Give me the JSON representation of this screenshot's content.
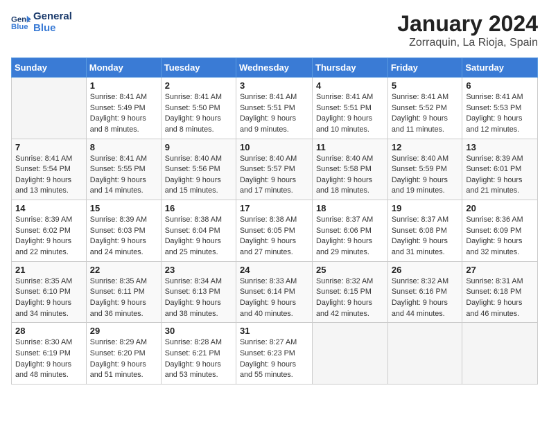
{
  "header": {
    "logo_line1": "General",
    "logo_line2": "Blue",
    "title": "January 2024",
    "subtitle": "Zorraquin, La Rioja, Spain"
  },
  "days_of_week": [
    "Sunday",
    "Monday",
    "Tuesday",
    "Wednesday",
    "Thursday",
    "Friday",
    "Saturday"
  ],
  "weeks": [
    [
      {
        "day": "",
        "detail": ""
      },
      {
        "day": "1",
        "detail": "Sunrise: 8:41 AM\nSunset: 5:49 PM\nDaylight: 9 hours\nand 8 minutes."
      },
      {
        "day": "2",
        "detail": "Sunrise: 8:41 AM\nSunset: 5:50 PM\nDaylight: 9 hours\nand 8 minutes."
      },
      {
        "day": "3",
        "detail": "Sunrise: 8:41 AM\nSunset: 5:51 PM\nDaylight: 9 hours\nand 9 minutes."
      },
      {
        "day": "4",
        "detail": "Sunrise: 8:41 AM\nSunset: 5:51 PM\nDaylight: 9 hours\nand 10 minutes."
      },
      {
        "day": "5",
        "detail": "Sunrise: 8:41 AM\nSunset: 5:52 PM\nDaylight: 9 hours\nand 11 minutes."
      },
      {
        "day": "6",
        "detail": "Sunrise: 8:41 AM\nSunset: 5:53 PM\nDaylight: 9 hours\nand 12 minutes."
      }
    ],
    [
      {
        "day": "7",
        "detail": "Sunrise: 8:41 AM\nSunset: 5:54 PM\nDaylight: 9 hours\nand 13 minutes."
      },
      {
        "day": "8",
        "detail": "Sunrise: 8:41 AM\nSunset: 5:55 PM\nDaylight: 9 hours\nand 14 minutes."
      },
      {
        "day": "9",
        "detail": "Sunrise: 8:40 AM\nSunset: 5:56 PM\nDaylight: 9 hours\nand 15 minutes."
      },
      {
        "day": "10",
        "detail": "Sunrise: 8:40 AM\nSunset: 5:57 PM\nDaylight: 9 hours\nand 17 minutes."
      },
      {
        "day": "11",
        "detail": "Sunrise: 8:40 AM\nSunset: 5:58 PM\nDaylight: 9 hours\nand 18 minutes."
      },
      {
        "day": "12",
        "detail": "Sunrise: 8:40 AM\nSunset: 5:59 PM\nDaylight: 9 hours\nand 19 minutes."
      },
      {
        "day": "13",
        "detail": "Sunrise: 8:39 AM\nSunset: 6:01 PM\nDaylight: 9 hours\nand 21 minutes."
      }
    ],
    [
      {
        "day": "14",
        "detail": "Sunrise: 8:39 AM\nSunset: 6:02 PM\nDaylight: 9 hours\nand 22 minutes."
      },
      {
        "day": "15",
        "detail": "Sunrise: 8:39 AM\nSunset: 6:03 PM\nDaylight: 9 hours\nand 24 minutes."
      },
      {
        "day": "16",
        "detail": "Sunrise: 8:38 AM\nSunset: 6:04 PM\nDaylight: 9 hours\nand 25 minutes."
      },
      {
        "day": "17",
        "detail": "Sunrise: 8:38 AM\nSunset: 6:05 PM\nDaylight: 9 hours\nand 27 minutes."
      },
      {
        "day": "18",
        "detail": "Sunrise: 8:37 AM\nSunset: 6:06 PM\nDaylight: 9 hours\nand 29 minutes."
      },
      {
        "day": "19",
        "detail": "Sunrise: 8:37 AM\nSunset: 6:08 PM\nDaylight: 9 hours\nand 31 minutes."
      },
      {
        "day": "20",
        "detail": "Sunrise: 8:36 AM\nSunset: 6:09 PM\nDaylight: 9 hours\nand 32 minutes."
      }
    ],
    [
      {
        "day": "21",
        "detail": "Sunrise: 8:35 AM\nSunset: 6:10 PM\nDaylight: 9 hours\nand 34 minutes."
      },
      {
        "day": "22",
        "detail": "Sunrise: 8:35 AM\nSunset: 6:11 PM\nDaylight: 9 hours\nand 36 minutes."
      },
      {
        "day": "23",
        "detail": "Sunrise: 8:34 AM\nSunset: 6:13 PM\nDaylight: 9 hours\nand 38 minutes."
      },
      {
        "day": "24",
        "detail": "Sunrise: 8:33 AM\nSunset: 6:14 PM\nDaylight: 9 hours\nand 40 minutes."
      },
      {
        "day": "25",
        "detail": "Sunrise: 8:32 AM\nSunset: 6:15 PM\nDaylight: 9 hours\nand 42 minutes."
      },
      {
        "day": "26",
        "detail": "Sunrise: 8:32 AM\nSunset: 6:16 PM\nDaylight: 9 hours\nand 44 minutes."
      },
      {
        "day": "27",
        "detail": "Sunrise: 8:31 AM\nSunset: 6:18 PM\nDaylight: 9 hours\nand 46 minutes."
      }
    ],
    [
      {
        "day": "28",
        "detail": "Sunrise: 8:30 AM\nSunset: 6:19 PM\nDaylight: 9 hours\nand 48 minutes."
      },
      {
        "day": "29",
        "detail": "Sunrise: 8:29 AM\nSunset: 6:20 PM\nDaylight: 9 hours\nand 51 minutes."
      },
      {
        "day": "30",
        "detail": "Sunrise: 8:28 AM\nSunset: 6:21 PM\nDaylight: 9 hours\nand 53 minutes."
      },
      {
        "day": "31",
        "detail": "Sunrise: 8:27 AM\nSunset: 6:23 PM\nDaylight: 9 hours\nand 55 minutes."
      },
      {
        "day": "",
        "detail": ""
      },
      {
        "day": "",
        "detail": ""
      },
      {
        "day": "",
        "detail": ""
      }
    ]
  ]
}
